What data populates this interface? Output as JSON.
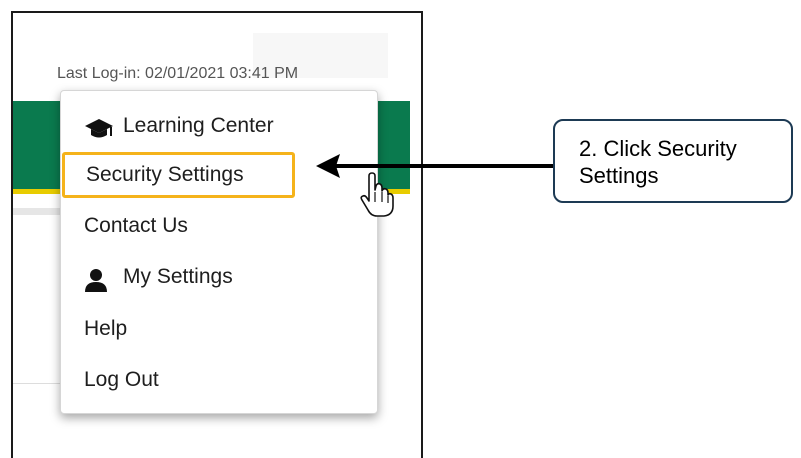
{
  "header": {
    "last_login": "Last Log-in: 02/01/2021 03:41 PM"
  },
  "menu": {
    "items": [
      {
        "label": "Learning Center",
        "icon": "graduation-cap-icon"
      },
      {
        "label": "Security Settings",
        "icon": ""
      },
      {
        "label": "Contact Us",
        "icon": ""
      },
      {
        "label": "My Settings",
        "icon": "person-icon"
      },
      {
        "label": "Help",
        "icon": ""
      },
      {
        "label": "Log Out",
        "icon": ""
      }
    ],
    "highlighted_item": "Security Settings"
  },
  "callout": {
    "text": "2. Click Security Settings"
  },
  "colors": {
    "brand_green": "#0a7a4e",
    "brand_yellow": "#e8cc00",
    "highlight_orange": "#f5b31b",
    "callout_border": "#1d3a54"
  }
}
